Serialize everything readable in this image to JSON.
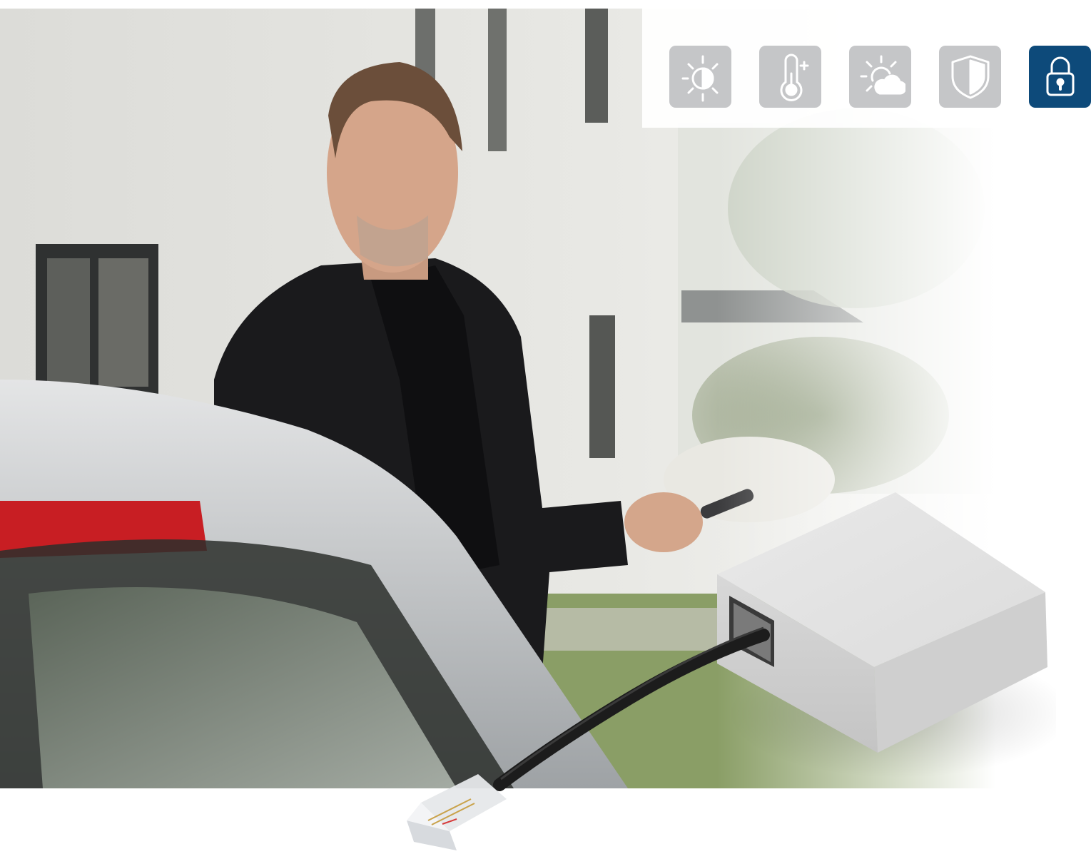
{
  "colors": {
    "tile_inactive": "#c5c6c8",
    "tile_active": "#0d4a7a",
    "icon_stroke": "#ffffff"
  },
  "icons": [
    {
      "name": "brightness-icon",
      "active": false
    },
    {
      "name": "thermometer-icon",
      "active": false
    },
    {
      "name": "sun-cloud-icon",
      "active": false
    },
    {
      "name": "shield-icon",
      "active": false
    },
    {
      "name": "padlock-icon",
      "active": true
    }
  ],
  "photo": {
    "subject": "photo-scene",
    "device": "interface-module-with-rj-cable"
  }
}
